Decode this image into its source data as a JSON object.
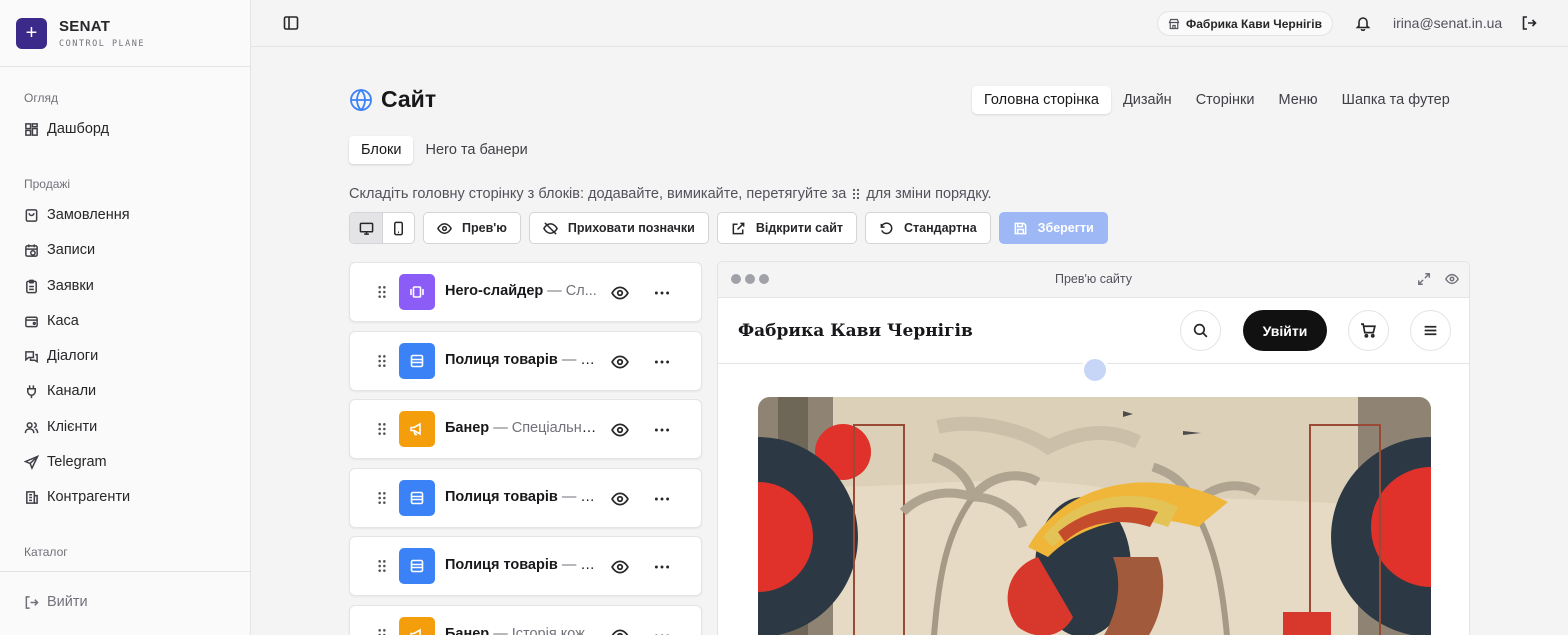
{
  "brand": {
    "name": "SENAT",
    "subtitle": "CONTROL PLANE"
  },
  "sidebar": {
    "sections": [
      {
        "label": "Огляд"
      },
      {
        "label": "Продажі"
      },
      {
        "label": "Каталог"
      }
    ],
    "items": [
      {
        "label": "Дашборд",
        "icon": "dashboard-icon"
      },
      {
        "label": "Замовлення",
        "icon": "shopping-bag-icon"
      },
      {
        "label": "Записи",
        "icon": "calendar-clock-icon"
      },
      {
        "label": "Заявки",
        "icon": "clipboard-icon"
      },
      {
        "label": "Каса",
        "icon": "wallet-icon"
      },
      {
        "label": "Діалоги",
        "icon": "chat-icon"
      },
      {
        "label": "Канали",
        "icon": "plug-icon"
      },
      {
        "label": "Клієнти",
        "icon": "users-icon"
      },
      {
        "label": "Telegram",
        "icon": "telegram-icon"
      },
      {
        "label": "Контрагенти",
        "icon": "building-icon"
      }
    ],
    "logout": "Вийти"
  },
  "topbar": {
    "store": "Фабрика Кави Чернігів",
    "email": "irina@senat.in.ua"
  },
  "page": {
    "title": "Сайт",
    "tabs": [
      "Головна сторінка",
      "Дизайн",
      "Сторінки",
      "Меню",
      "Шапка та футер"
    ],
    "active_tab": "Головна сторінка",
    "sub_tabs": [
      "Блоки",
      "Hero та банери"
    ],
    "hint_before": "Складіть головну сторінку з блоків: додавайте, вимикайте, перетягуйте за",
    "hint_after": "для зміни порядку."
  },
  "toolbar": {
    "preview": "Прев'ю",
    "hide_labels": "Приховати позначки",
    "open_site": "Відкрити сайт",
    "default": "Стандартна",
    "save": "Зберегти"
  },
  "blocks": [
    {
      "title": "Hero-слайдер",
      "desc": " — Сл...",
      "color": "#8b5cf6",
      "icon": "slider-icon"
    },
    {
      "title": "Полиця товарів",
      "desc": " — Р...",
      "color": "#3b82f6",
      "icon": "shelf-icon"
    },
    {
      "title": "Банер",
      "desc": " — Спеціальні ...",
      "color": "#f59e0b",
      "icon": "megaphone-icon"
    },
    {
      "title": "Полиця товарів",
      "desc": " — Н...",
      "color": "#3b82f6",
      "icon": "shelf-icon"
    },
    {
      "title": "Полиця товарів",
      "desc": " — Хі...",
      "color": "#3b82f6",
      "icon": "shelf-icon"
    },
    {
      "title": "Банер",
      "desc": " — Історія кож...",
      "color": "#f59e0b",
      "icon": "megaphone-icon"
    }
  ],
  "preview": {
    "bar_title": "Прев'ю сайту",
    "site_name": "Фабрика Кави Чернігів",
    "login": "Увійти"
  }
}
